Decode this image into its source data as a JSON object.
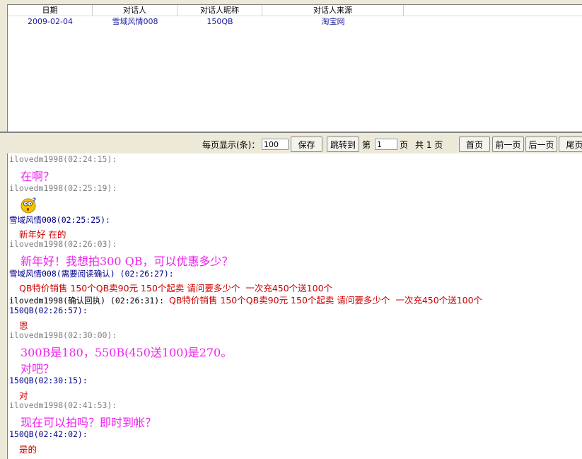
{
  "grid": {
    "columns": [
      "日期",
      "对话人",
      "对话人昵称",
      "对话人来源"
    ],
    "rows": [
      [
        "2009-02-04",
        "雪域风情008",
        "150QB",
        "淘宝网"
      ]
    ]
  },
  "toolbar": {
    "per_page_label": "每页显示(条)：",
    "per_page_value": "100",
    "save": "保存",
    "jump": "跳转到",
    "page_prefix": "第",
    "page_value": "1",
    "page_suffix": "页",
    "total": "共 1 页",
    "first": "首页",
    "prev": "前一页",
    "next": "后一页",
    "last": "尾页"
  },
  "colors": {
    "self_header": "#808080",
    "peer_header": "#00008b",
    "self_msg": "#ee22ee",
    "peer_msg": "#d00000"
  },
  "messages": [
    {
      "t": "h",
      "c": "gray",
      "text": "ilovedm1998(02:24:15):"
    },
    {
      "t": "mag",
      "text": "在啊？"
    },
    {
      "t": "h",
      "c": "gray",
      "text": "ilovedm1998(02:25:19):"
    },
    {
      "t": "emoji",
      "text": "",
      "icon": "confused-face-emoticon"
    },
    {
      "t": "h",
      "c": "blue",
      "text": "雪域风情008(02:25:25):"
    },
    {
      "t": "red",
      "text": "新年好 在的"
    },
    {
      "t": "h",
      "c": "gray",
      "text": "ilovedm1998(02:26:03):"
    },
    {
      "t": "mag",
      "text": "新年好！我想拍300 QB，可以优惠多少？"
    },
    {
      "t": "h",
      "c": "blue",
      "text": "雪域风情008(需要阅读确认) (02:26:27):"
    },
    {
      "t": "red",
      "text": "QB特价销售 150个QB卖90元 150个起卖 请问要多少个  一次充450个送100个"
    },
    {
      "t": "receipt",
      "text": "ilovedm1998(确认回执) (02:26:31): ",
      "extra": "QB特价销售 150个QB卖90元 150个起卖 请问要多少个  一次充450个送100个"
    },
    {
      "t": "h",
      "c": "blue",
      "text": "150QB(02:26:57):"
    },
    {
      "t": "red",
      "text": "恩"
    },
    {
      "t": "h",
      "c": "gray",
      "text": "ilovedm1998(02:30:00):"
    },
    {
      "t": "mag",
      "text": "300B是180，550B(450送100)是270。"
    },
    {
      "t": "mag",
      "text": "对吧？"
    },
    {
      "t": "h",
      "c": "blue",
      "text": "150QB(02:30:15):"
    },
    {
      "t": "red",
      "text": "对"
    },
    {
      "t": "h",
      "c": "gray",
      "text": "ilovedm1998(02:41:53):"
    },
    {
      "t": "mag",
      "text": "现在可以拍吗？即时到帐？"
    },
    {
      "t": "h",
      "c": "blue",
      "text": "150QB(02:42:02):"
    },
    {
      "t": "red",
      "text": "是的"
    }
  ]
}
